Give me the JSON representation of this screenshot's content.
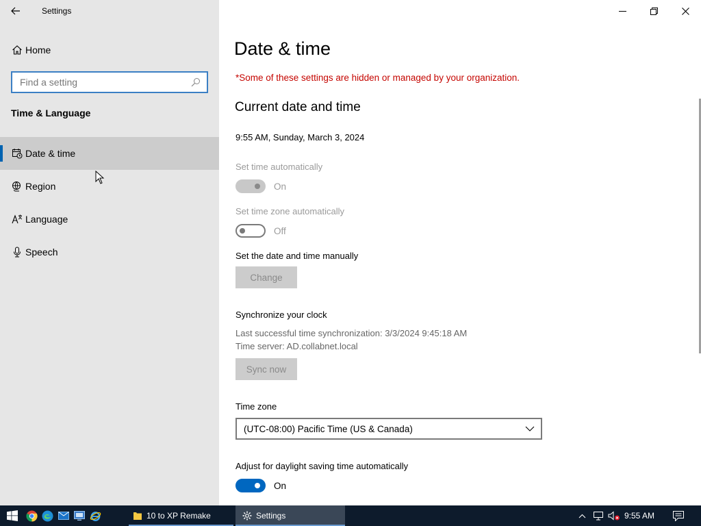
{
  "window": {
    "title": "Settings"
  },
  "sidebar": {
    "home_label": "Home",
    "search_placeholder": "Find a setting",
    "section_title": "Time & Language",
    "items": [
      {
        "label": "Date & time",
        "icon": "calendar-clock-icon",
        "selected": true
      },
      {
        "label": "Region",
        "icon": "globe-icon",
        "selected": false
      },
      {
        "label": "Language",
        "icon": "language-icon",
        "selected": false
      },
      {
        "label": "Speech",
        "icon": "microphone-icon",
        "selected": false
      }
    ]
  },
  "main": {
    "page_title": "Date & time",
    "org_note": "*Some of these settings are hidden or managed by your organization.",
    "current_heading": "Current date and time",
    "current_datetime": "9:55 AM, Sunday, March 3, 2024",
    "set_time_auto": {
      "label": "Set time automatically",
      "state": "On"
    },
    "set_tz_auto": {
      "label": "Set time zone automatically",
      "state": "Off"
    },
    "manual": {
      "label": "Set the date and time manually",
      "button": "Change"
    },
    "sync": {
      "heading": "Synchronize your clock",
      "last_sync": "Last successful time synchronization: 3/3/2024 9:45:18 AM",
      "server": "Time server: AD.collabnet.local",
      "button": "Sync now"
    },
    "timezone": {
      "label": "Time zone",
      "value": "(UTC-08:00) Pacific Time (US & Canada)"
    },
    "dst": {
      "label": "Adjust for daylight saving time automatically",
      "state": "On"
    }
  },
  "taskbar": {
    "tasks": [
      {
        "label": "10 to XP Remake"
      },
      {
        "label": "Settings"
      }
    ],
    "clock": "9:55 AM"
  },
  "colors": {
    "accent": "#0067c0",
    "warning": "#c50500",
    "sidebar_bg": "#e6e6e6",
    "taskbar_bg": "#0d1b2c"
  }
}
